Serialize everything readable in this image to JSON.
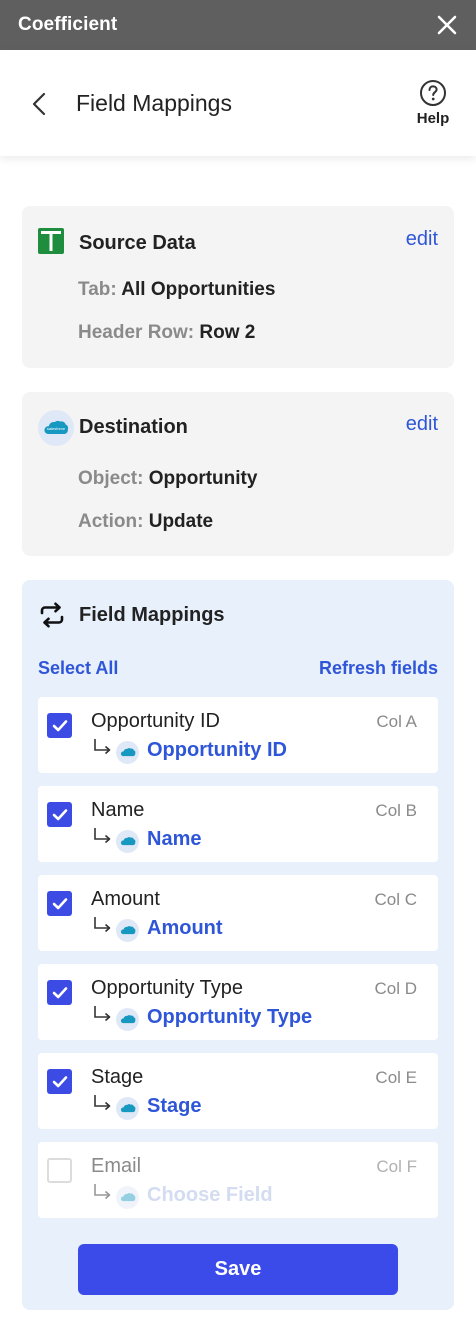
{
  "app": {
    "title": "Coefficient"
  },
  "header": {
    "title": "Field Mappings",
    "help_label": "Help"
  },
  "source": {
    "title": "Source Data",
    "edit_label": "edit",
    "tab_key": "Tab:",
    "tab_value": "All Opportunities",
    "header_row_key": "Header Row:",
    "header_row_value": "Row 2"
  },
  "destination": {
    "title": "Destination",
    "edit_label": "edit",
    "object_key": "Object:",
    "object_value": "Opportunity",
    "action_key": "Action:",
    "action_value": "Update"
  },
  "field_mappings": {
    "title": "Field Mappings",
    "select_all_label": "Select All",
    "refresh_label": "Refresh fields",
    "rows": [
      {
        "name": "Opportunity ID",
        "col": "Col A",
        "target": "Opportunity ID",
        "checked": true
      },
      {
        "name": "Name",
        "col": "Col B",
        "target": "Name",
        "checked": true
      },
      {
        "name": "Amount",
        "col": "Col C",
        "target": "Amount",
        "checked": true
      },
      {
        "name": "Opportunity Type",
        "col": "Col D",
        "target": "Opportunity Type",
        "checked": true
      },
      {
        "name": "Stage",
        "col": "Col E",
        "target": "Stage",
        "checked": true
      },
      {
        "name": "Email",
        "col": "Col F",
        "target": "Choose Field",
        "checked": false
      }
    ],
    "save_label": "Save"
  },
  "colors": {
    "titlebar": "#5f5f5f",
    "accent_blue": "#2f56d8",
    "checkbox_blue": "#3b4be3",
    "save_button": "#3b4be9",
    "mappings_panel": "#e8f0fc",
    "card_gray": "#f4f4f4",
    "sheets_green": "#1e8e3e",
    "salesforce_blue": "#1798c1"
  },
  "icons": {
    "close": "close-icon",
    "back": "chevron-left-icon",
    "help": "help-circle-icon",
    "source": "google-sheets-icon",
    "destination": "salesforce-icon",
    "mappings": "sync-arrows-icon",
    "mapping_arrow": "subdirectory-arrow-right-icon"
  }
}
